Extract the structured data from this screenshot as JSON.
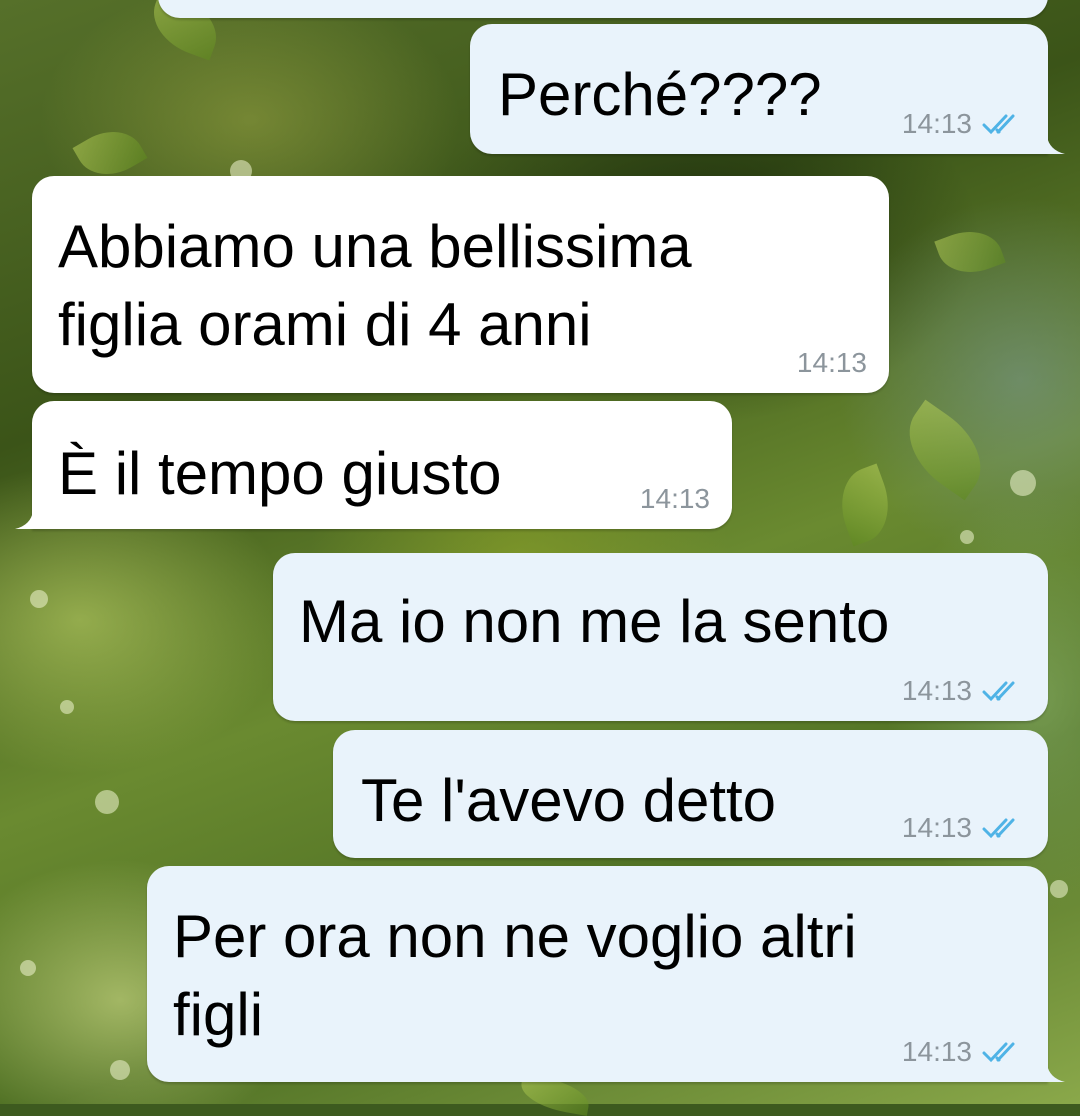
{
  "chat": {
    "messages": [
      {
        "direction": "outgoing",
        "lines": [],
        "time": ""
      },
      {
        "direction": "outgoing",
        "lines": [
          "Perché????"
        ],
        "time": "14:13",
        "status": "read"
      },
      {
        "direction": "incoming",
        "lines": [
          "Abbiamo una bellissima",
          "figlia orami di 4 anni"
        ],
        "time": "14:13"
      },
      {
        "direction": "incoming",
        "lines": [
          "È il tempo giusto"
        ],
        "time": "14:13"
      },
      {
        "direction": "outgoing",
        "lines": [
          "Ma io non me la sento"
        ],
        "time": "14:13",
        "status": "read"
      },
      {
        "direction": "outgoing",
        "lines": [
          "Te l'avevo detto"
        ],
        "time": "14:13",
        "status": "read"
      },
      {
        "direction": "outgoing",
        "lines": [
          "Per ora non ne voglio altri",
          "figli"
        ],
        "time": "14:13",
        "status": "read"
      }
    ]
  },
  "theme": {
    "outgoing_bubble": "#e9f3fb",
    "incoming_bubble": "#ffffff",
    "read_tick_color": "#4fb3e6",
    "time_color": "#8c959c",
    "wallpaper": "green foliage with bokeh"
  }
}
